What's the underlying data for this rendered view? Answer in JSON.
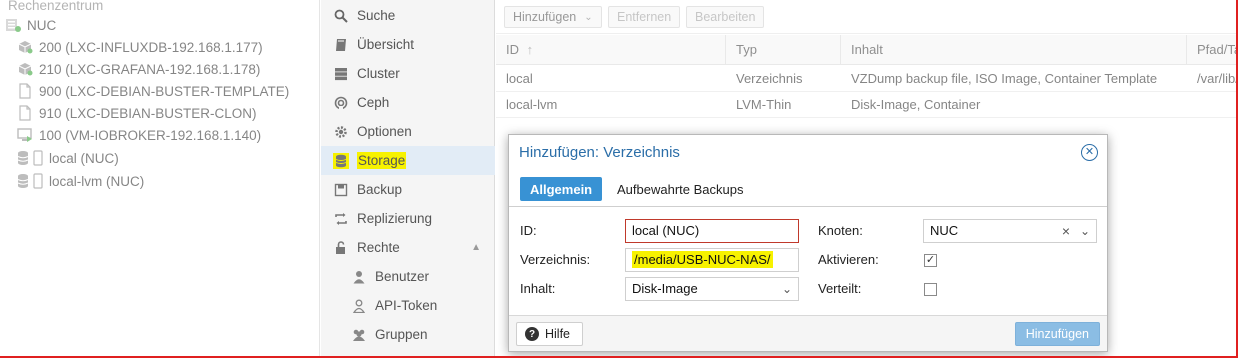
{
  "tree": {
    "root_label": "Rechenzentrum",
    "node_label": "NUC",
    "items": [
      {
        "label": "200 (LXC-INFLUXDB-192.168.1.177)",
        "icon": "container-icon"
      },
      {
        "label": "210 (LXC-GRAFANA-192.168.1.178)",
        "icon": "container-icon"
      },
      {
        "label": "900 (LXC-DEBIAN-BUSTER-TEMPLATE)",
        "icon": "template-icon"
      },
      {
        "label": "910 (LXC-DEBIAN-BUSTER-CLON)",
        "icon": "template-icon"
      },
      {
        "label": "100 (VM-IOBROKER-192.168.1.140)",
        "icon": "vm-icon"
      },
      {
        "label": "local (NUC)",
        "icon": "storage-icon"
      },
      {
        "label": "local-lvm (NUC)",
        "icon": "storage-icon"
      }
    ]
  },
  "sidebar": {
    "items": [
      {
        "label": "Suche",
        "icon": "search-icon"
      },
      {
        "label": "Übersicht",
        "icon": "book-icon"
      },
      {
        "label": "Cluster",
        "icon": "server-icon"
      },
      {
        "label": "Ceph",
        "icon": "ceph-icon"
      },
      {
        "label": "Optionen",
        "icon": "gear-icon"
      },
      {
        "label": "Storage",
        "icon": "database-icon"
      },
      {
        "label": "Backup",
        "icon": "floppy-icon"
      },
      {
        "label": "Replizierung",
        "icon": "retweet-icon"
      },
      {
        "label": "Rechte",
        "icon": "unlock-icon"
      },
      {
        "label": "Benutzer",
        "icon": "user-icon"
      },
      {
        "label": "API-Token",
        "icon": "user-outline-icon"
      },
      {
        "label": "Gruppen",
        "icon": "users-icon"
      }
    ],
    "selected": "Storage"
  },
  "toolbar": {
    "add_label": "Hinzufügen",
    "remove_label": "Entfernen",
    "edit_label": "Bearbeiten"
  },
  "grid": {
    "columns": [
      "ID",
      "Typ",
      "Inhalt",
      "Pfad/Ta"
    ],
    "rows": [
      {
        "id": "local",
        "typ": "Verzeichnis",
        "inhalt": "VZDump backup file, ISO Image, Container Template",
        "pfad": "/var/lib/"
      },
      {
        "id": "local-lvm",
        "typ": "LVM-Thin",
        "inhalt": "Disk-Image, Container",
        "pfad": ""
      }
    ]
  },
  "dialog": {
    "title": "Hinzufügen: Verzeichnis",
    "tabs": [
      "Allgemein",
      "Aufbewahrte Backups"
    ],
    "fields": {
      "id_label": "ID:",
      "id_value": "local (NUC)",
      "dir_label": "Verzeichnis:",
      "dir_value": "/media/USB-NUC-NAS/",
      "content_label": "Inhalt:",
      "content_value": "Disk-Image",
      "node_label": "Knoten:",
      "node_value": "NUC",
      "enable_label": "Aktivieren:",
      "enable_checked": true,
      "shared_label": "Verteilt:",
      "shared_checked": false
    },
    "help_label": "Hilfe",
    "submit_label": "Hinzufügen"
  },
  "colors": {
    "accent": "#3892d4",
    "title_blue": "#2b6ea8",
    "highlight": "#f7f200",
    "error_border": "#c0392b"
  }
}
